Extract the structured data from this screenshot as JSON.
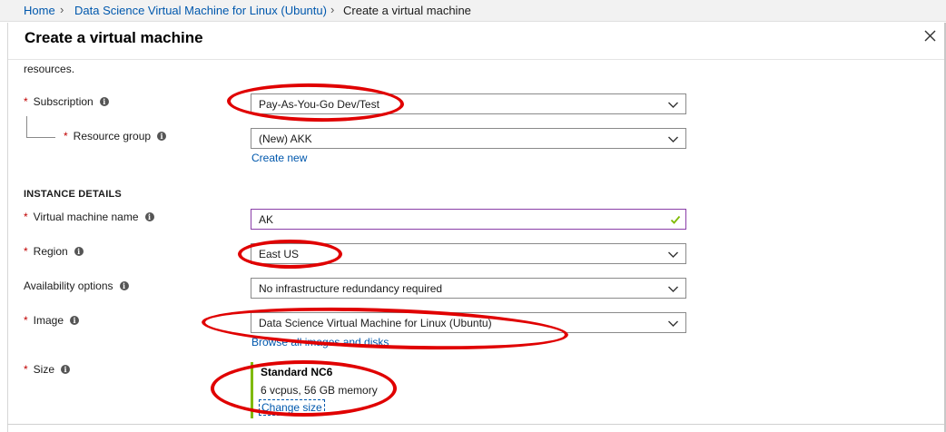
{
  "breadcrumb": {
    "home": "Home",
    "marketplace_item": "Data Science Virtual Machine for Linux (Ubuntu)",
    "current": "Create a virtual machine",
    "separator": "›"
  },
  "blade": {
    "title": "Create a virtual machine",
    "close_icon": "close-icon"
  },
  "intro_fragment": "resources.",
  "project": {
    "subscription": {
      "label": "Subscription",
      "required": "*",
      "value": "Pay-As-You-Go Dev/Test"
    },
    "resource_group": {
      "label": "Resource group",
      "required": "*",
      "value": "(New) AKK",
      "create_new": "Create new"
    }
  },
  "instance": {
    "heading": "INSTANCE DETAILS",
    "vm_name": {
      "label": "Virtual machine name",
      "required": "*",
      "value": "AK",
      "valid_icon": "checkmark-icon"
    },
    "region": {
      "label": "Region",
      "required": "*",
      "value": "East US"
    },
    "availability": {
      "label": "Availability options",
      "value": "No infrastructure redundancy required"
    },
    "image": {
      "label": "Image",
      "required": "*",
      "value": "Data Science Virtual Machine for Linux (Ubuntu)",
      "browse": "Browse all images and disks"
    },
    "size": {
      "label": "Size",
      "required": "*",
      "name": "Standard NC6",
      "spec": "6 vcpus, 56 GB memory",
      "change": "Change size"
    }
  },
  "info_icon_glyph": "i",
  "colors": {
    "link": "#0058ad",
    "required": "#c00000",
    "annotation": "#e00000",
    "valid": "#7fba00",
    "input_focus": "#8a3ea8"
  }
}
